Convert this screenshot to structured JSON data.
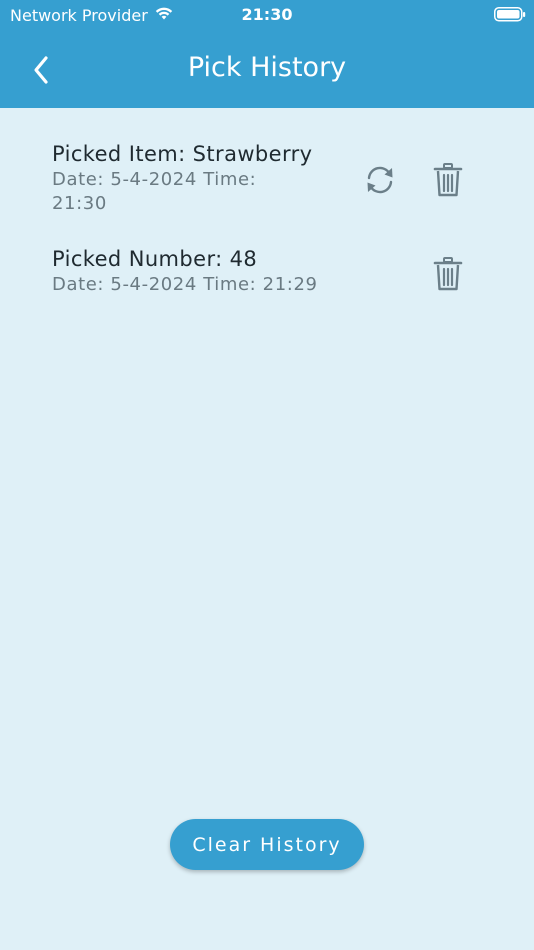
{
  "status_bar": {
    "carrier": "Network Provider",
    "time": "21:30"
  },
  "header": {
    "title": "Pick History"
  },
  "history": [
    {
      "title": "Picked Item: Strawberry",
      "date_time_line1": "Date: 5-4-2024  Time:",
      "date_time_line2": "21:30",
      "has_refresh": true
    },
    {
      "title": "Picked Number: 48",
      "date_time_line1": "Date: 5-4-2024  Time: 21:29",
      "has_refresh": false
    }
  ],
  "footer": {
    "clear_label": "Clear History"
  },
  "colors": {
    "primary": "#369fd0",
    "background": "#dff0f7",
    "icon": "#6b7f89"
  }
}
